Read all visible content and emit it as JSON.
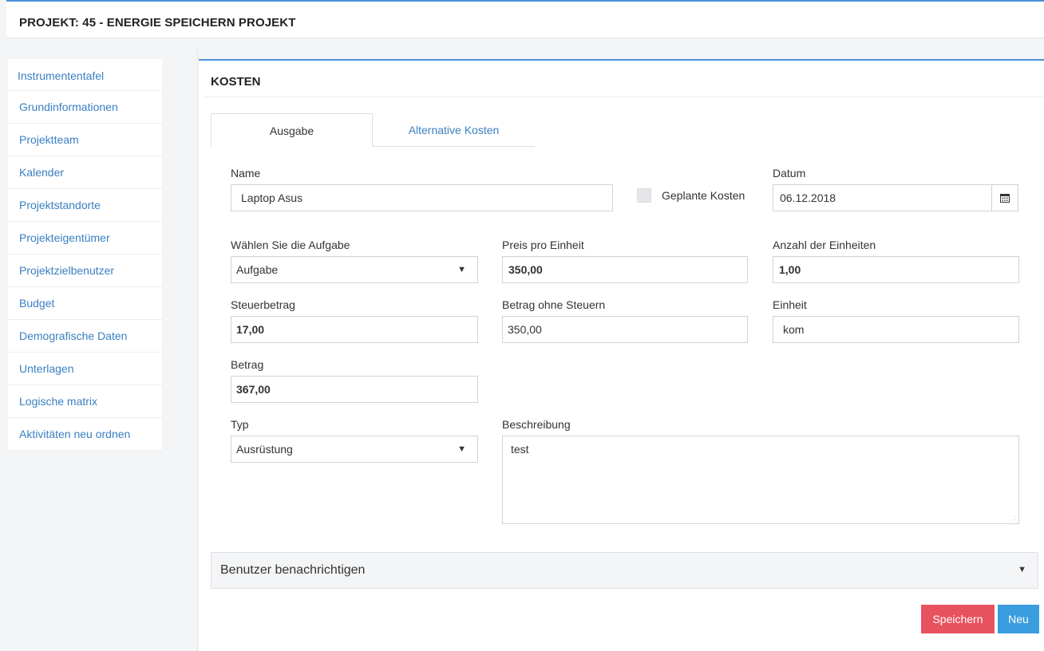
{
  "header": {
    "title": "PROJEKT: 45 - ENERGIE SPEICHERN PROJEKT"
  },
  "sidebar": {
    "items": [
      {
        "label": "Instrumententafel"
      },
      {
        "label": "Grundinformationen"
      },
      {
        "label": "Projektteam"
      },
      {
        "label": "Kalender"
      },
      {
        "label": "Projektstandorte"
      },
      {
        "label": "Projekteigentümer"
      },
      {
        "label": "Projektzielbenutzer"
      },
      {
        "label": "Budget"
      },
      {
        "label": "Demografische Daten"
      },
      {
        "label": "Unterlagen"
      },
      {
        "label": "Logische matrix"
      },
      {
        "label": "Aktivitäten neu ordnen"
      }
    ]
  },
  "card": {
    "title": "KOSTEN"
  },
  "tabs": [
    {
      "label": "Ausgabe",
      "active": true
    },
    {
      "label": "Alternative Kosten",
      "active": false
    }
  ],
  "form": {
    "name": {
      "label": "Name",
      "value": "Laptop Asus"
    },
    "planned": {
      "label": "Geplante Kosten",
      "checked": false
    },
    "datum": {
      "label": "Datum",
      "value": "06.12.2018",
      "icon": "calendar-icon"
    },
    "aufgabe": {
      "label": "Wählen Sie die Aufgabe",
      "value": "Aufgabe"
    },
    "preis": {
      "label": "Preis pro Einheit",
      "value": "350,00"
    },
    "anzahl": {
      "label": "Anzahl der Einheiten",
      "value": "1,00"
    },
    "steuer": {
      "label": "Steuerbetrag",
      "value": "17,00"
    },
    "ohne_steuern": {
      "label": "Betrag ohne Steuern",
      "value": "350,00"
    },
    "einheit": {
      "label": "Einheit",
      "value": "kom"
    },
    "betrag": {
      "label": "Betrag",
      "value": "367,00"
    },
    "typ": {
      "label": "Typ",
      "value": "Ausrüstung"
    },
    "beschreibung": {
      "label": "Beschreibung",
      "value": "test"
    }
  },
  "notify": {
    "label": "Benutzer benachrichtigen"
  },
  "buttons": {
    "save": "Speichern",
    "new": "Neu"
  },
  "colors": {
    "accent": "#4a90d9",
    "link": "#3a7fc1",
    "save": "#e8525f",
    "new": "#3a9de0"
  }
}
